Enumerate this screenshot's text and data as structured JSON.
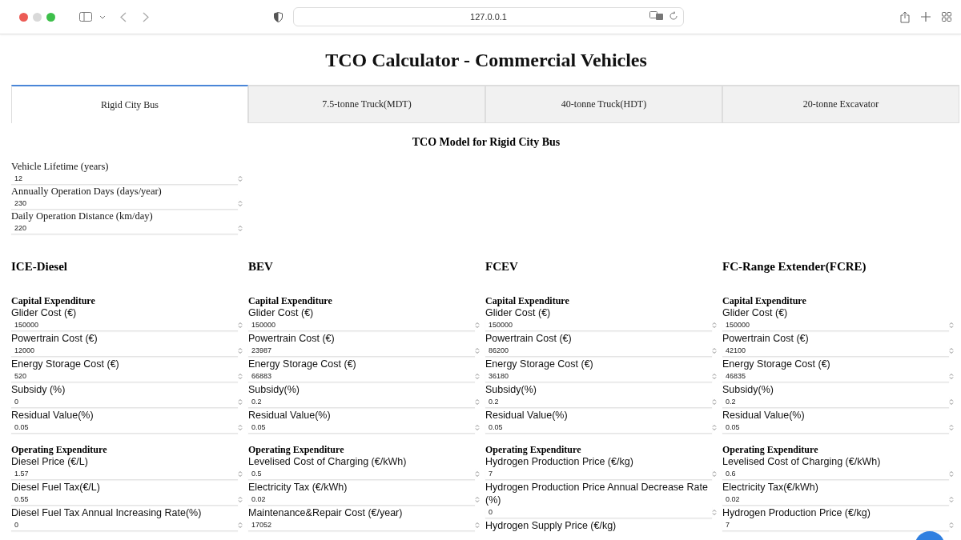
{
  "browser": {
    "url": "127.0.0.1"
  },
  "title": "TCO Calculator - Commercial Vehicles",
  "tabs": [
    {
      "label": "Rigid City Bus",
      "selected": true
    },
    {
      "label": "7.5-tonne Truck(MDT)",
      "selected": false
    },
    {
      "label": "40-tonne Truck(HDT)",
      "selected": false
    },
    {
      "label": "20-tonne Excavator",
      "selected": false
    }
  ],
  "model_title": "TCO Model for Rigid City Bus",
  "general_fields": [
    {
      "label": "Vehicle Lifetime (years)",
      "value": "12"
    },
    {
      "label": "Annually Operation Days (days/year)",
      "value": "230"
    },
    {
      "label": "Daily Operation Distance (km/day)",
      "value": "220"
    }
  ],
  "vehicles": [
    {
      "title": "ICE-Diesel",
      "sections": [
        {
          "heading": "Capital Expenditure",
          "fields": [
            {
              "label": "Glider Cost (€)",
              "value": "150000"
            },
            {
              "label": "Powertrain Cost (€)",
              "value": "12000"
            },
            {
              "label": "Energy Storage Cost (€)",
              "value": "520"
            },
            {
              "label": "Subsidy (%)",
              "value": "0"
            },
            {
              "label": "Residual Value(%)",
              "value": "0.05"
            }
          ]
        },
        {
          "heading": "Operating Expenditure",
          "fields": [
            {
              "label": "Diesel Price (€/L)",
              "value": "1.57"
            },
            {
              "label": "Diesel Fuel Tax(€/L)",
              "value": "0.55"
            },
            {
              "label": "Diesel Fuel Tax Annual Increasing Rate(%)",
              "value": "0"
            }
          ]
        }
      ]
    },
    {
      "title": "BEV",
      "sections": [
        {
          "heading": "Capital Expenditure",
          "fields": [
            {
              "label": "Glider Cost (€)",
              "value": "150000"
            },
            {
              "label": "Powertrain Cost (€)",
              "value": "23987"
            },
            {
              "label": "Energy Storage Cost (€)",
              "value": "66883"
            },
            {
              "label": "Subsidy(%)",
              "value": "0.2"
            },
            {
              "label": "Residual Value(%)",
              "value": "0.05"
            }
          ]
        },
        {
          "heading": "Operating Expenditure",
          "fields": [
            {
              "label": "Levelised Cost of Charging (€/kWh)",
              "value": "0.5"
            },
            {
              "label": "Electricity Tax (€/kWh)",
              "value": "0.02"
            },
            {
              "label": "Maintenance&Repair Cost (€/year)",
              "value": "17052"
            }
          ]
        }
      ]
    },
    {
      "title": "FCEV",
      "sections": [
        {
          "heading": "Capital Expenditure",
          "fields": [
            {
              "label": "Glider Cost (€)",
              "value": "150000"
            },
            {
              "label": "Powertrain Cost (€)",
              "value": "86200"
            },
            {
              "label": "Energy Storage Cost (€)",
              "value": "36180"
            },
            {
              "label": "Subsidy(%)",
              "value": "0.2"
            },
            {
              "label": "Residual Value(%)",
              "value": "0.05"
            }
          ]
        },
        {
          "heading": "Operating Expenditure",
          "fields": [
            {
              "label": "Hydrogen Production Price (€/kg)",
              "value": "7"
            },
            {
              "label": "Hydrogen Production Price Annual Decrease Rate (%)",
              "value": "0"
            },
            {
              "label": "Hydrogen Supply Price (€/kg)"
            }
          ]
        }
      ]
    },
    {
      "title": "FC-Range Extender(FCRE)",
      "sections": [
        {
          "heading": "Capital Expenditure",
          "fields": [
            {
              "label": "Glider Cost (€)",
              "value": "150000"
            },
            {
              "label": "Powertrain Cost (€)",
              "value": "42100"
            },
            {
              "label": "Energy Storage Cost (€)",
              "value": "46835"
            },
            {
              "label": "Subsidy(%)",
              "value": "0.2"
            },
            {
              "label": "Residual Value(%)",
              "value": "0.05"
            }
          ]
        },
        {
          "heading": "Operating Expenditure",
          "fields": [
            {
              "label": "Levelised Cost of Charging (€/kWh)",
              "value": "0.6"
            },
            {
              "label": "Electricity Tax(€/kWh)",
              "value": "0.02"
            },
            {
              "label": "Hydrogen Production Price (€/kg)",
              "value": "7"
            }
          ]
        }
      ]
    }
  ]
}
